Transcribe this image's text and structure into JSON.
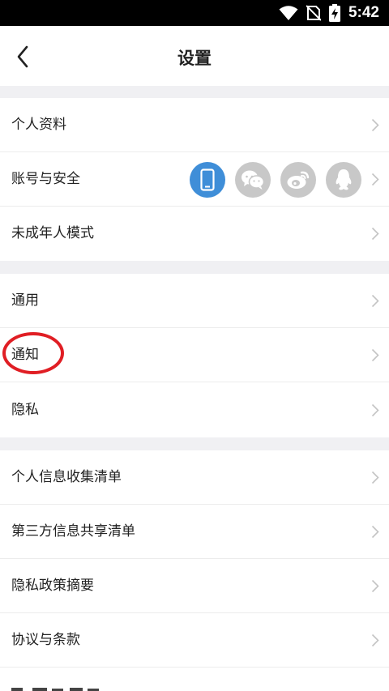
{
  "status_bar": {
    "time": "5:42"
  },
  "header": {
    "title": "设置"
  },
  "sections": [
    {
      "items": [
        {
          "label": "个人资料"
        },
        {
          "label": "账号与安全",
          "bindings": [
            "phone-icon",
            "wechat-icon",
            "weibo-icon",
            "qq-icon"
          ]
        },
        {
          "label": "未成年人模式"
        }
      ]
    },
    {
      "items": [
        {
          "label": "通用"
        },
        {
          "label": "通知"
        },
        {
          "label": "隐私"
        }
      ]
    },
    {
      "items": [
        {
          "label": "个人信息收集清单"
        },
        {
          "label": "第三方信息共享清单"
        },
        {
          "label": "隐私政策摘要"
        },
        {
          "label": "协议与条款"
        }
      ]
    }
  ],
  "colors": {
    "phone_binding": "#3f8ed8",
    "unbound": "#c8c8c8",
    "annotation": "#e01e24",
    "section_gap": "#f0f0f3"
  }
}
